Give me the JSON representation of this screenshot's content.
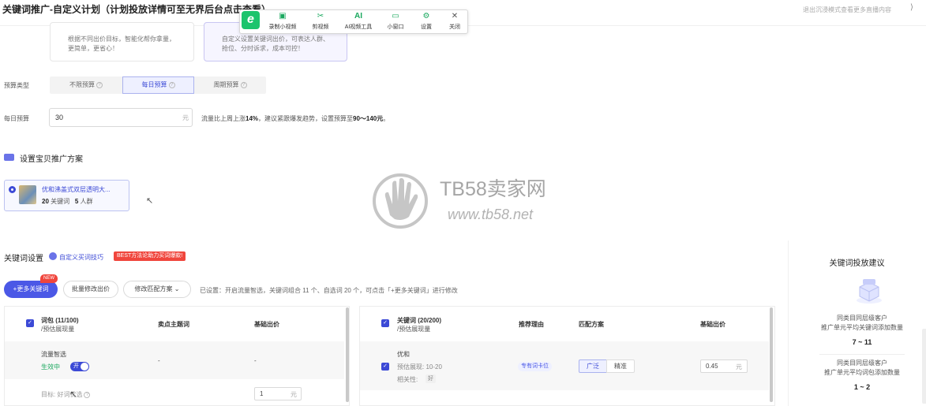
{
  "page": {
    "title": "关键词推广-自定义计划（计划投放详情可至无界后台点击查看）",
    "exit_link": "退出沉浸模式查看更多直播内容",
    "corner_mark": "⟩"
  },
  "toolbar": {
    "logo_char": "e",
    "items": [
      {
        "icon": "video-record-icon",
        "glyph": "▣",
        "label": "录制小视频"
      },
      {
        "icon": "scissors-icon",
        "glyph": "✂",
        "label": "剪视频"
      },
      {
        "icon": "ai-icon",
        "glyph": "AI",
        "label": "AI视频工具"
      },
      {
        "icon": "tv-icon",
        "glyph": "▭",
        "label": "小窗口"
      },
      {
        "icon": "gear-icon",
        "glyph": "⚙",
        "label": "设置"
      },
      {
        "icon": "close-icon",
        "glyph": "✕",
        "label": "关闭"
      }
    ]
  },
  "strategy_cards": [
    {
      "text_line1": "根据不同出价目标，智能化帮你拿量，",
      "text_line2": "更简单，更省心！",
      "selected": false
    },
    {
      "text_line1": "自定义设置关键词出价，可表达人群、",
      "text_line2": "抢位、分时诉求，成本可控！",
      "selected": true
    }
  ],
  "budget_type": {
    "label": "预算类型",
    "options": [
      "不限预算",
      "每日预算",
      "周期预算"
    ],
    "selected": "每日预算"
  },
  "daily_budget": {
    "label": "每日预算",
    "value": "30",
    "unit": "元",
    "tip_prefix": "流量比上周上涨",
    "tip_pct": "14%",
    "tip_mid": "，建议紧跟爆发趋势，设置预算至",
    "tip_range": "90～140元",
    "tip_end": "。"
  },
  "item_section": {
    "title": "设置宝贝推广方案",
    "item": {
      "name": "优和沸盖式双层透明大...",
      "kw_count": "20",
      "kw_label": "关键词",
      "crowd_count": "5",
      "crowd_label": "人群"
    }
  },
  "watermark": {
    "brand": "TB58卖家网",
    "url": "www.tb58.net"
  },
  "keyword_section": {
    "title": "关键词设置",
    "tip": "自定义买词技巧",
    "best_tag": "BEST方法论助力买词爆款!",
    "more_button": "+更多关键词",
    "new_tag": "NEW",
    "batch_bid_button": "批量修改出价",
    "match_plan_button": "修改匹配方案",
    "set_info": "已设置：开启流量智选，关键词组合 11 个、自选词 20 个，可点击「+更多关键词」进行修改"
  },
  "left_table": {
    "col1": "词包 (11/100)",
    "col1_sub": "/预估展现量",
    "col2": "卖点主题词",
    "col3": "基础出价",
    "row_name": "流量智选",
    "row_status": "生效中",
    "toggle_label": "开",
    "row_dash1": "-",
    "row_dash2": "-",
    "target_label": "目标:",
    "target_value": "好词优选",
    "bid_value": "1",
    "bid_unit": "元"
  },
  "right_table": {
    "col1": "关键词 (20/200)",
    "col1_sub": "/预估展现量",
    "col2": "推荐理由",
    "col3": "匹配方案",
    "col4": "基础出价",
    "row_kw": "优和",
    "row_est": "预估展现: 10-20",
    "row_rel": "相关性:",
    "row_rel_tag": "好",
    "reason_tag": "专有词卡位",
    "match_broad": "广泛",
    "match_exact": "精准",
    "bid_value": "0.45",
    "bid_unit": "元"
  },
  "advice_panel": {
    "title": "关键词投放建议",
    "block1_line1": "同类目同层级客户",
    "block1_line2": "推广单元平均关键词添加数量",
    "block1_value": "7 ~ 11",
    "block2_line1": "同类目同层级客户",
    "block2_line2": "推广单元平均词包添加数量",
    "block2_value": "1 ~ 2"
  },
  "colors": {
    "accent": "#4b58e6",
    "green": "#1aa85e",
    "red": "#f0463d"
  }
}
